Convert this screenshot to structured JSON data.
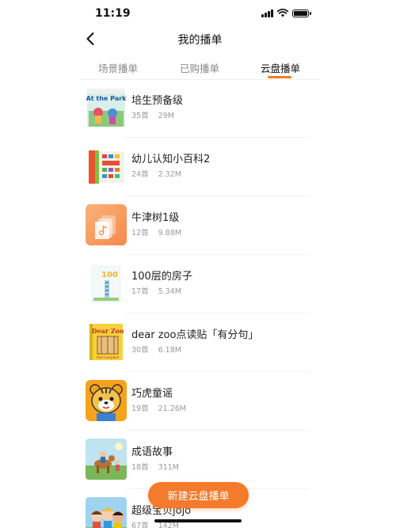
{
  "status_bar": {
    "time": "11:19",
    "icons": [
      "signal-icon",
      "wifi-icon",
      "battery-icon"
    ]
  },
  "nav": {
    "title": "我的播单",
    "back_icon": "chevron-left-icon"
  },
  "tabs": [
    {
      "label": "场景播单",
      "active": false
    },
    {
      "label": "已购播单",
      "active": false
    },
    {
      "label": "云盘播单",
      "active": true
    }
  ],
  "items": [
    {
      "title": "培生预备级",
      "count": "35首",
      "size": "29M",
      "cover": "book-cover-at-the-park"
    },
    {
      "title": "幼儿认知小百科2",
      "count": "24首",
      "size": "2.32M",
      "cover": "book-cover-encyclopedia"
    },
    {
      "title": "牛津树1级",
      "count": "12首",
      "size": "9.88M",
      "cover": "cloud-folder-icon"
    },
    {
      "title": "100层的房子",
      "count": "17首",
      "size": "5.34M",
      "cover": "book-cover-100-floors"
    },
    {
      "title": "dear zoo点读贴「有分句」",
      "count": "30首",
      "size": "6.18M",
      "cover": "book-cover-dear-zoo"
    },
    {
      "title": "巧虎童谣",
      "count": "19首",
      "size": "21.26M",
      "cover": "tiger-character-cover"
    },
    {
      "title": "成语故事",
      "count": "18首",
      "size": "311M",
      "cover": "idiom-story-cover"
    },
    {
      "title": "超级宝贝jojo",
      "count": "67首",
      "size": "142M",
      "cover": "cocomelon-cover"
    }
  ],
  "new_button": {
    "label": "新建云盘播单"
  },
  "colors": {
    "accent": "#f47a2c",
    "text": "#222222",
    "muted": "#999999"
  }
}
